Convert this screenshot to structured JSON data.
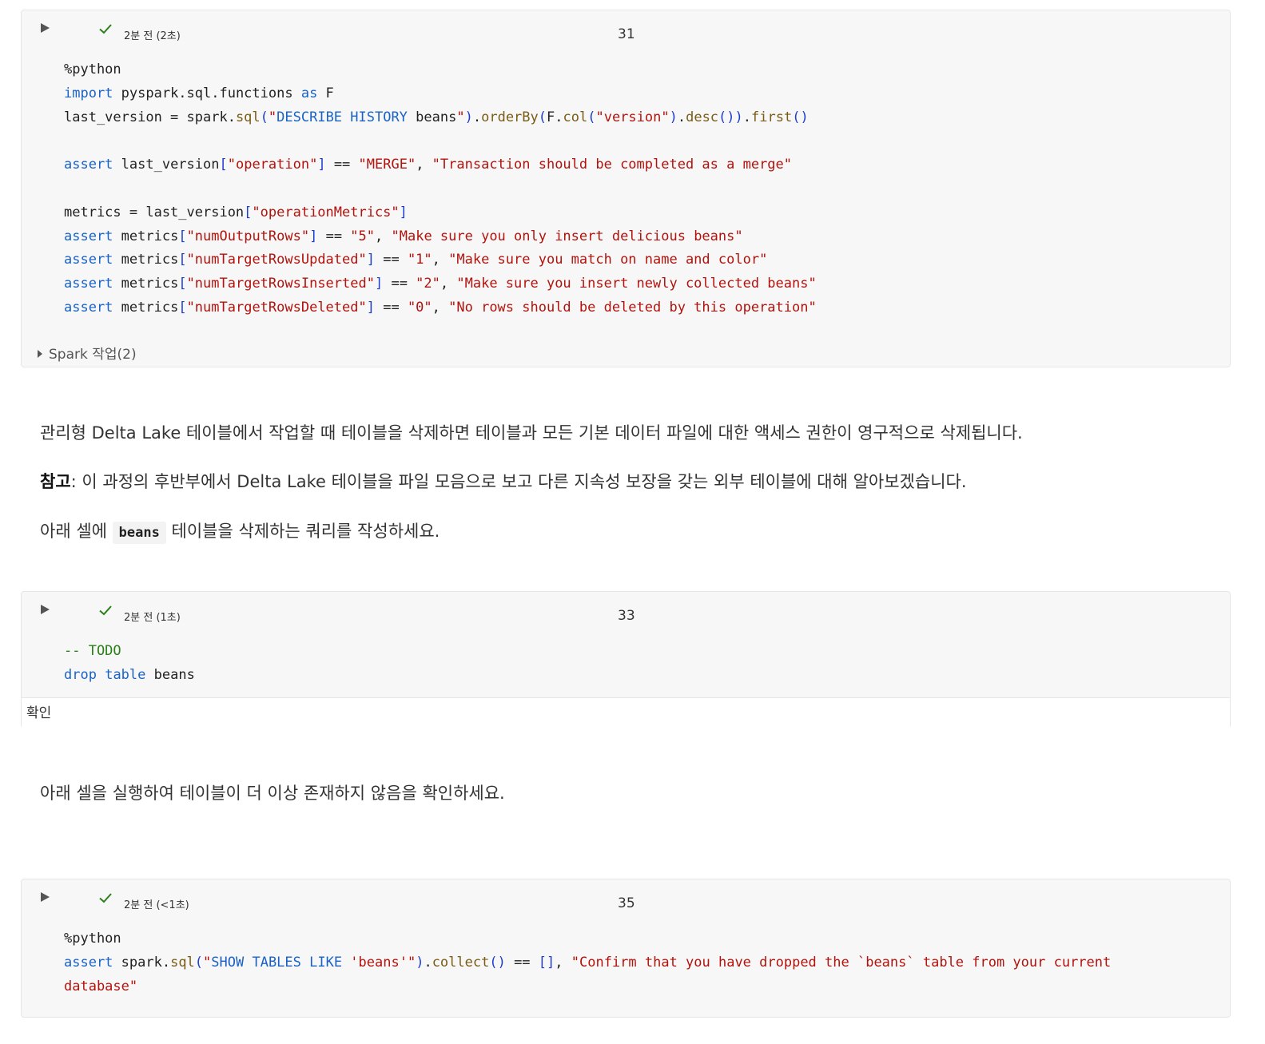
{
  "cells": [
    {
      "status": "2분 전 (2초)",
      "number": "31",
      "code_lines": [
        "%python",
        "import pyspark.sql.functions as F",
        "last_version = spark.sql(\"DESCRIBE HISTORY beans\").orderBy(F.col(\"version\").desc()).first()",
        "",
        "assert last_version[\"operation\"] == \"MERGE\", \"Transaction should be completed as a merge\"",
        "",
        "metrics = last_version[\"operationMetrics\"]",
        "assert metrics[\"numOutputRows\"] == \"5\", \"Make sure you only insert delicious beans\"",
        "assert metrics[\"numTargetRowsUpdated\"] == \"1\", \"Make sure you match on name and color\"",
        "assert metrics[\"numTargetRowsInserted\"] == \"2\", \"Make sure you insert newly collected beans\"",
        "assert metrics[\"numTargetRowsDeleted\"] == \"0\", \"No rows should be deleted by this operation\""
      ],
      "spark_jobs": "Spark 작업(2)"
    },
    {
      "status": "2분 전 (1초)",
      "number": "33",
      "code_lines": [
        "-- TODO",
        "drop table beans"
      ],
      "result": "확인"
    },
    {
      "status": "2분 전 (<1초)",
      "number": "35",
      "code_lines": [
        "%python",
        "assert spark.sql(\"SHOW TABLES LIKE 'beans'\").collect() == [], \"Confirm that you have dropped the `beans` table from your current",
        "database\""
      ]
    }
  ],
  "markdown": {
    "p1": "관리형 Delta Lake 테이블에서 작업할 때 테이블을 삭제하면 테이블과 모든 기본 데이터 파일에 대한 액세스 권한이 영구적으로 삭제됩니다.",
    "p2_bold": "참고",
    "p2_rest": ": 이 과정의 후반부에서 Delta Lake 테이블을 파일 모음으로 보고 다른 지속성 보장을 갖는 외부 테이블에 대해 알아보겠습니다.",
    "p3_before": "아래 셀에 ",
    "p3_code": "beans",
    "p3_after": " 테이블을 삭제하는 쿼리를 작성하세요.",
    "p4": "아래 셀을 실행하여 테이블이 더 이상 존재하지 않음을 확인하세요."
  },
  "colors": {
    "keyword": "#1a63c5",
    "string": "#b3130c",
    "comment": "#2b7f17",
    "check": "#2b7f17"
  },
  "icons": [
    "run-icon",
    "check-icon",
    "expand-icon"
  ]
}
